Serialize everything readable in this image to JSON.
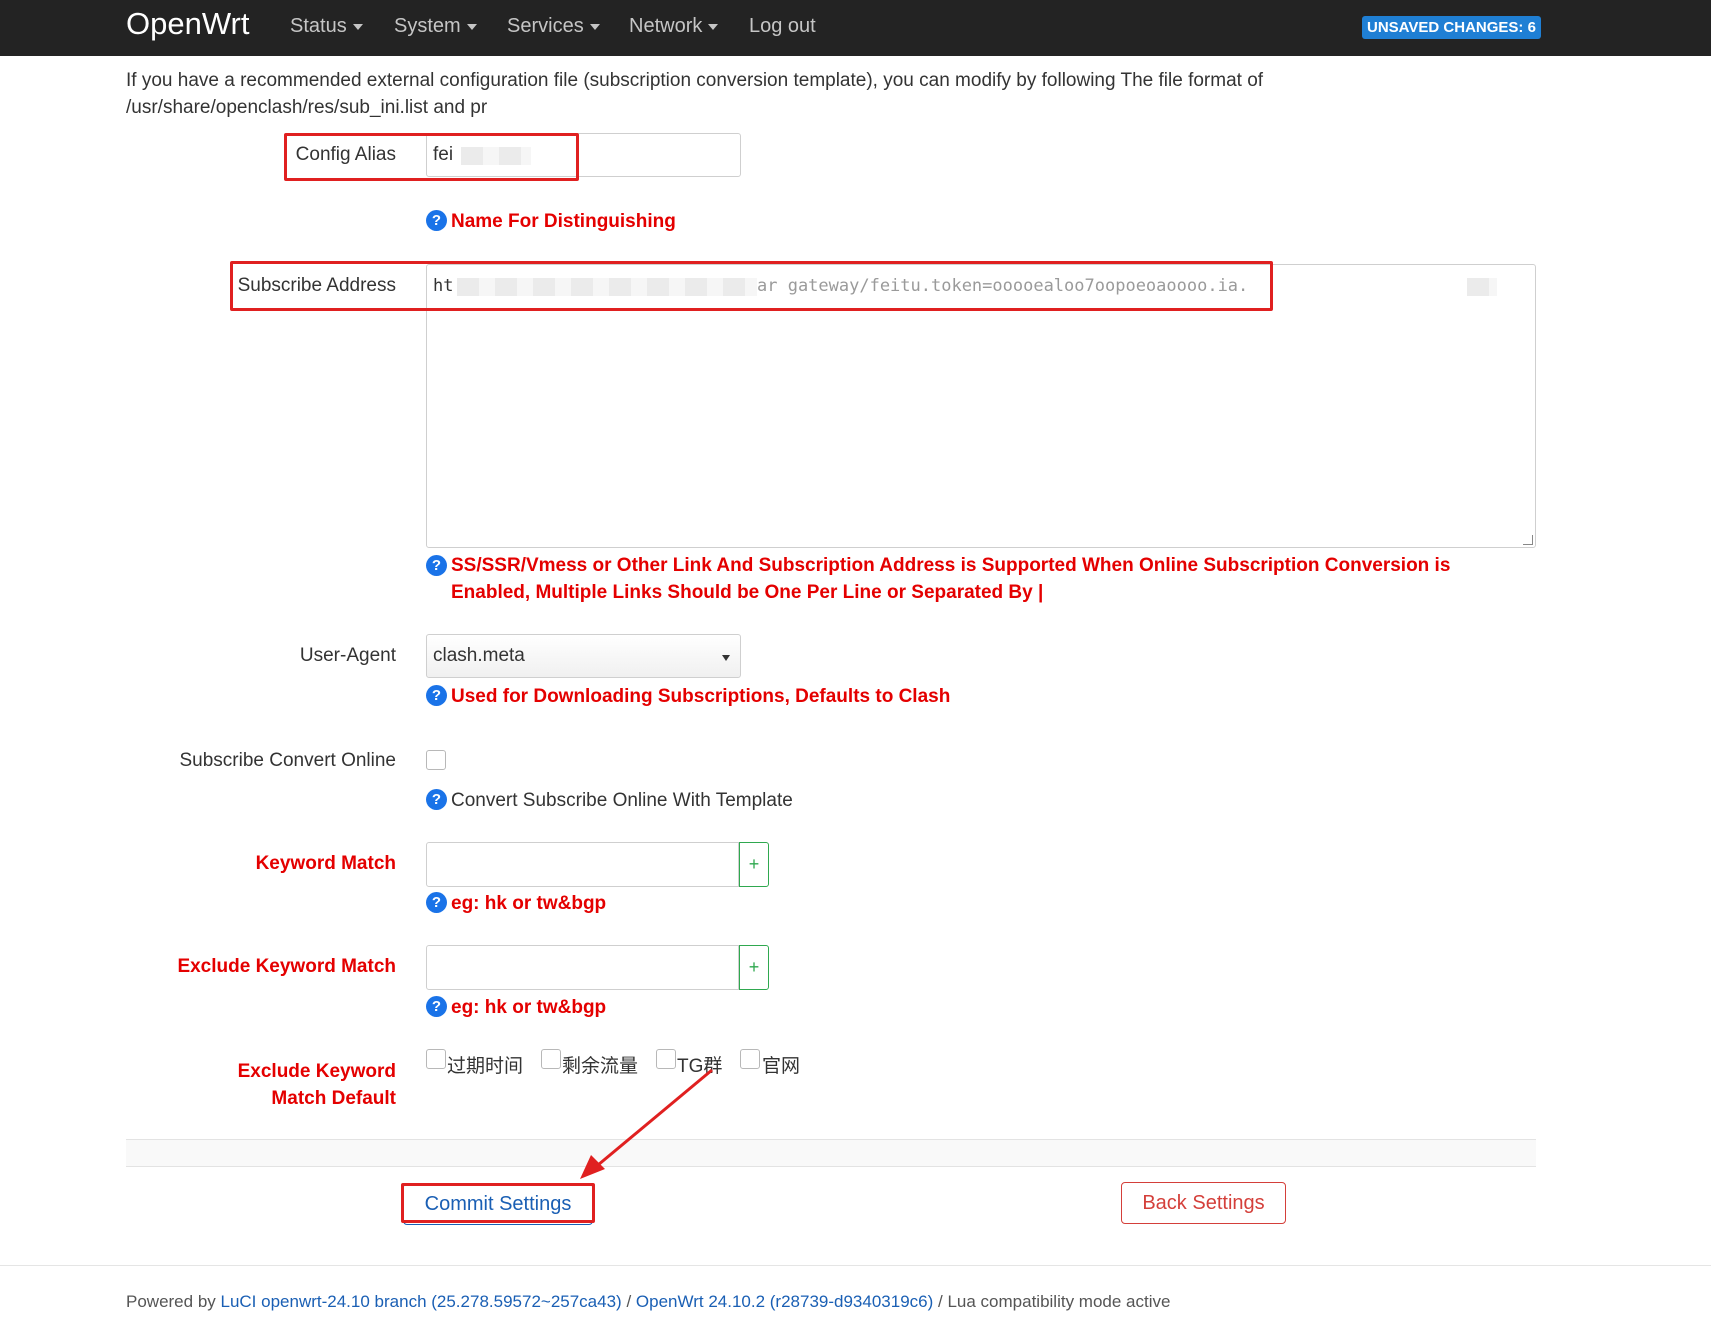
{
  "navbar": {
    "brand": "OpenWrt",
    "items": [
      {
        "label": "Status",
        "dropdown": true
      },
      {
        "label": "System",
        "dropdown": true
      },
      {
        "label": "Services",
        "dropdown": true
      },
      {
        "label": "Network",
        "dropdown": true
      },
      {
        "label": "Log out",
        "dropdown": false
      }
    ],
    "unsaved_badge": "UNSAVED CHANGES: 6"
  },
  "intro_text": "If you have a recommended external configuration file (subscription conversion template), you can modify by following The file format of /usr/share/openclash/res/sub_ini.list and pr",
  "form": {
    "config_alias": {
      "label": "Config Alias",
      "value_visible": "fei",
      "help": "Name For Distinguishing"
    },
    "subscribe_address": {
      "label": "Subscribe Address",
      "value_visible_start": "ht",
      "value_visible_middle": "ar gateway/feitu.token=ooooealoo7oopoeoaoooo.ia.",
      "help": "SS/SSR/Vmess or Other Link And Subscription Address is Supported When Online Subscription Conversion is Enabled, Multiple Links Should be One Per Line or Separated By |"
    },
    "user_agent": {
      "label": "User-Agent",
      "value": "clash.meta",
      "help": "Used for Downloading Subscriptions, Defaults to Clash"
    },
    "subscribe_convert_online": {
      "label": "Subscribe Convert Online",
      "checked": false,
      "help": "Convert Subscribe Online With Template"
    },
    "keyword_match": {
      "label": "Keyword Match",
      "value": "",
      "help": "eg: hk or tw&bgp",
      "add_button": "+"
    },
    "exclude_keyword_match": {
      "label": "Exclude Keyword Match",
      "value": "",
      "help": "eg: hk or tw&bgp",
      "add_button": "+"
    },
    "exclude_keyword_match_default": {
      "label": "Exclude Keyword Match Default",
      "options": [
        {
          "label": "过期时间",
          "checked": false
        },
        {
          "label": "剩余流量",
          "checked": false
        },
        {
          "label": "TG群",
          "checked": false
        },
        {
          "label": "官网",
          "checked": false
        }
      ]
    }
  },
  "actions": {
    "commit": "Commit Settings",
    "back": "Back Settings"
  },
  "footer": {
    "prefix": "Powered by ",
    "luci": "LuCI openwrt-24.10 branch (25.278.59572~257ca43)",
    "sep1": " / ",
    "openwrt": "OpenWrt 24.10.2 (r28739-d9340319c6)",
    "sep2": " / ",
    "suffix": "Lua compatibility mode active"
  },
  "colors": {
    "navbar_bg": "#232323",
    "badge": "#1f7fd4",
    "help_red": "#e40000",
    "annotation": "#e02020",
    "link": "#1a5fb4"
  }
}
